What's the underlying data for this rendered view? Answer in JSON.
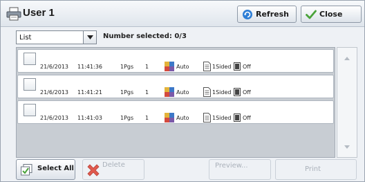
{
  "header": {
    "title": "User 1",
    "refresh_label": "Refresh",
    "close_label": "Close"
  },
  "toolbar": {
    "view_select_value": "List",
    "number_selected": "Number selected: 0/3"
  },
  "jobs": [
    {
      "date": "21/6/2013",
      "time": "11:41:36",
      "pages": "1Pgs",
      "copies": "1",
      "color_mode": "Auto",
      "sided": "1Sided",
      "staple": "Off",
      "checked": false
    },
    {
      "date": "21/6/2013",
      "time": "11:41:21",
      "pages": "1Pgs",
      "copies": "1",
      "color_mode": "Auto",
      "sided": "1Sided",
      "staple": "Off",
      "checked": false
    },
    {
      "date": "21/6/2013",
      "time": "11:41:03",
      "pages": "1Pgs",
      "copies": "1",
      "color_mode": "Auto",
      "sided": "1Sided",
      "staple": "Off",
      "checked": false
    }
  ],
  "footer": {
    "select_all_label": "Select All",
    "delete_label": "Delete",
    "preview_label": "Preview...",
    "print_label": "Print"
  },
  "icons": {
    "title": "printer-icon",
    "refresh": "refresh-icon",
    "close": "checkmark-icon",
    "color_mode": "color-mode-icon",
    "sided": "document-sided-icon",
    "staple": "staple-icon",
    "select_all": "select-all-icon",
    "delete": "delete-x-icon"
  },
  "colors": {
    "header_bg": "#e6ebf1",
    "list_bg": "#c8cdd3",
    "delete_icon": "#e05a4e",
    "checkmark": "#4aa33a",
    "refresh_icon": "#2f7fd6"
  }
}
